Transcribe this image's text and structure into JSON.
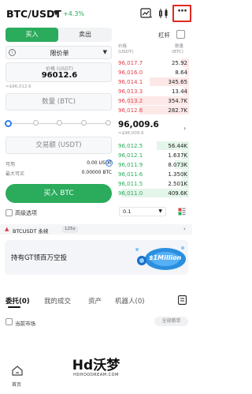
{
  "header": {
    "pair": "BTC/USDT",
    "change": "+4.3%",
    "icons": [
      "chart-icon",
      "candlestick-icon",
      "more-icon"
    ]
  },
  "order_form": {
    "tabs": [
      "买入",
      "卖出"
    ],
    "leverage_label": "杠杆",
    "order_type": "限价单",
    "price_label": "价格 (USDT)",
    "price_value": "96012.6",
    "price_approx": "≈$96,012.6",
    "quantity_placeholder": "数量 (BTC)",
    "total_placeholder": "交易额 (USDT)",
    "available_label": "可用",
    "available_value": "0.00 USDT",
    "max_buy_label": "最大可买",
    "max_buy_value": "0.00000 BTC",
    "buy_button": "买入 BTC",
    "advanced_label": "高级选项",
    "slider_percent": 0
  },
  "order_book": {
    "head_price": "价格\n(USDT)",
    "head_qty": "数量\n(BTC)",
    "asks": [
      {
        "price": "96,017.7",
        "qty": "25.92",
        "depth": 0.1
      },
      {
        "price": "96,016.0",
        "qty": "8.64",
        "depth": 0.06
      },
      {
        "price": "96,014.1",
        "qty": "345.65",
        "depth": 0.55
      },
      {
        "price": "96,013.3",
        "qty": "13.44",
        "depth": 0.08
      },
      {
        "price": "96,013.2",
        "qty": "354.7K",
        "depth": 0.85
      },
      {
        "price": "96,012.6",
        "qty": "282.7K",
        "depth": 0.7
      }
    ],
    "mid_price": "96,009.6",
    "mid_approx": "≈$96,009.6",
    "bids": [
      {
        "price": "96,012.5",
        "qty": "56.44K",
        "depth": 0.45
      },
      {
        "price": "96,012.1",
        "qty": "1.637K",
        "depth": 0.1
      },
      {
        "price": "96,011.9",
        "qty": "8.073K",
        "depth": 0.2
      },
      {
        "price": "96,011.6",
        "qty": "1.350K",
        "depth": 0.1
      },
      {
        "price": "96,011.5",
        "qty": "2.501K",
        "depth": 0.12
      },
      {
        "price": "96,011.0",
        "qty": "409.6K",
        "depth": 0.95
      }
    ],
    "depth_select": "0.1"
  },
  "perp": {
    "label": "BTCUSDT 永续",
    "badge": "125x"
  },
  "banner": {
    "text": "持有GT领百万空投",
    "art_text": "$1Million"
  },
  "bottom_tabs": {
    "tabs": [
      "委托(0)",
      "我的成交",
      "资产",
      "机器人(0)"
    ],
    "current_market_label": "当前市场",
    "cancel_all_label": "全部撤单"
  },
  "nav": {
    "home_label": "首页"
  },
  "watermark": {
    "main": "Hd沃梦",
    "sub": "HDHOODREAM.COM"
  }
}
